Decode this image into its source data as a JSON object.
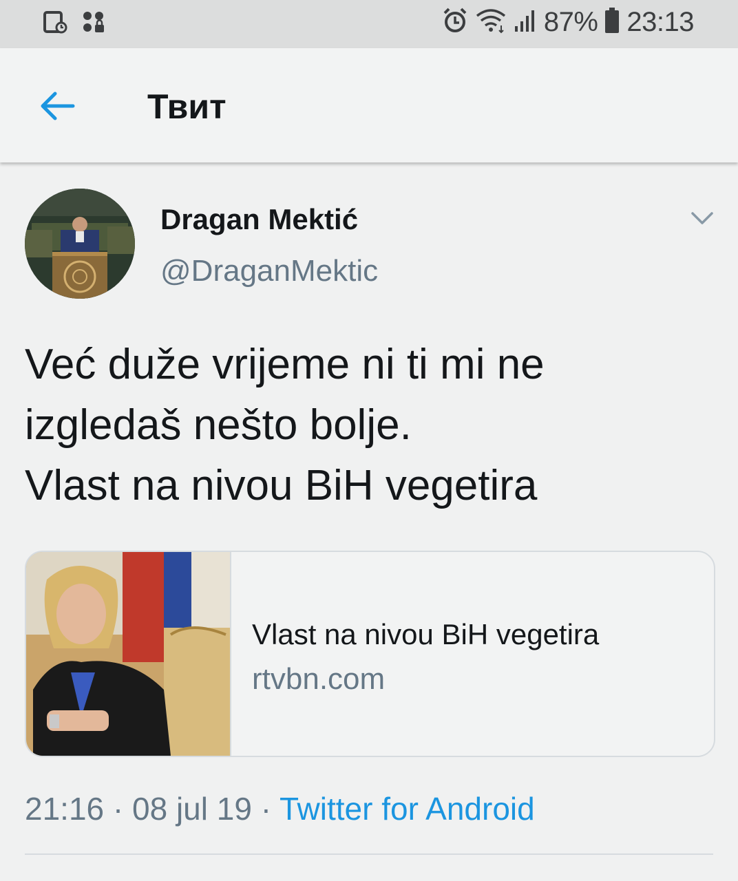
{
  "status_bar": {
    "battery": "87%",
    "time": "23:13",
    "icons": [
      "screenshot-icon",
      "vpn-lock-icon",
      "alarm-icon",
      "wifi-icon",
      "signal-icon",
      "battery-icon"
    ]
  },
  "header": {
    "title": "Твит",
    "back_icon": "arrow-left-icon"
  },
  "tweet": {
    "author_name": "Dragan Mektić",
    "author_handle": "@DraganMektic",
    "text_lines": [
      "Već duže vrijeme ni ti mi ne",
      "izgledaš nešto bolje.",
      "Vlast na nivou BiH vegetira"
    ],
    "card": {
      "title": "Vlast na nivou BiH vegetira",
      "domain": "rtvbn.com"
    },
    "time": "21:16",
    "date": "08 jul 19",
    "separator": "·",
    "source": "Twitter for Android"
  },
  "colors": {
    "background": "#f0f1f1",
    "accent": "#1b95e0",
    "secondary_text": "#657786",
    "primary_text": "#14171a"
  }
}
